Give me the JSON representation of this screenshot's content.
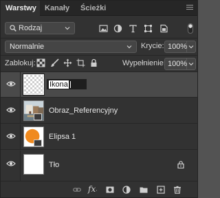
{
  "tabs": [
    {
      "label": "Warstwy",
      "active": true
    },
    {
      "label": "Kanały",
      "active": false
    },
    {
      "label": "Ścieżki",
      "active": false
    }
  ],
  "filter": {
    "kind_label": "Rodzaj",
    "icons": [
      "image-filter-icon",
      "adjustment-filter-icon",
      "type-filter-icon",
      "shape-filter-icon",
      "smart-object-filter-icon"
    ]
  },
  "blend": {
    "mode": "Normalnie",
    "opacity_label": "Krycie:",
    "opacity_value": "100%"
  },
  "lock": {
    "label": "Zablokuj:",
    "fill_label": "Wypełnienie:",
    "fill_value": "100%"
  },
  "layers": [
    {
      "name": "Ikona",
      "selected": true,
      "renaming": true,
      "thumb": "transparent"
    },
    {
      "name": "Obraz_Referencyjny",
      "selected": false,
      "thumb": "photo",
      "smart_object": true
    },
    {
      "name": "Elipsa 1",
      "selected": false,
      "thumb": "ellipse",
      "smart_object": true
    },
    {
      "name": "Tło",
      "selected": false,
      "thumb": "white",
      "locked": true
    }
  ],
  "bottom_icons": [
    "link-layers-icon",
    "layer-style-icon",
    "add-mask-icon",
    "adjustment-layer-icon",
    "new-group-icon",
    "new-layer-icon",
    "delete-layer-icon"
  ],
  "fx_text": "fx",
  "colors": {
    "panel_bg": "#323232",
    "tabbar_bg": "#262626",
    "selected_row": "#4a4a4a",
    "ellipse_orange": "#f08a1e",
    "text": "#e8e8e8"
  }
}
